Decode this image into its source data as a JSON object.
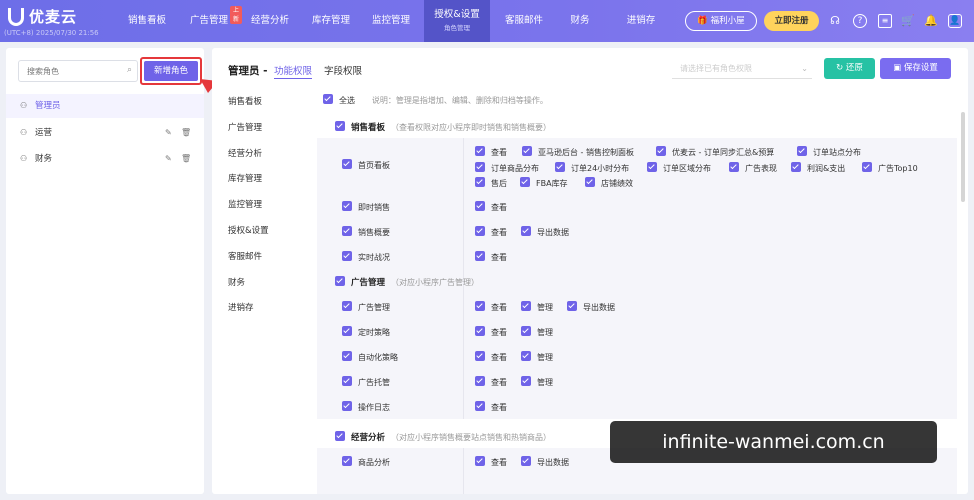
{
  "app": {
    "logo_text": "优麦云",
    "region_text": "(UTC+8) 2025/07/30 21:56"
  },
  "nav": [
    {
      "label": "销售看板"
    },
    {
      "label": "广告管理",
      "badge": "上新"
    },
    {
      "label": "经营分析"
    },
    {
      "label": "库存管理"
    },
    {
      "label": "监控管理"
    },
    {
      "label": "授权&设置",
      "sub": "角色管理"
    },
    {
      "label": "客服邮件"
    },
    {
      "label": "财务"
    },
    {
      "label": "进销存"
    }
  ],
  "header_actions": {
    "welfare_label": "福利小屋",
    "welfare_icon": "gift-icon",
    "register_label": "立即注册"
  },
  "header_icons": [
    "headset-icon",
    "help-icon",
    "message-icon",
    "cart-icon",
    "bell-icon",
    "user-icon"
  ],
  "left": {
    "search_placeholder": "搜索角色",
    "new_role_label": "新增角色",
    "roles": [
      {
        "label": "管理员",
        "active": true,
        "editable": false
      },
      {
        "label": "运营",
        "active": false,
        "editable": true
      },
      {
        "label": "财务",
        "active": false,
        "editable": true
      }
    ]
  },
  "main": {
    "title": "管理员 -",
    "tabs": [
      "功能权限",
      "字段权限"
    ],
    "copy_placeholder": "请选择已有角色权限",
    "restore_label": "还原",
    "save_label": "保存设置",
    "side_nav": [
      "销售看板",
      "广告管理",
      "经营分析",
      "库存管理",
      "监控管理",
      "授权&设置",
      "客服邮件",
      "财务",
      "进销存"
    ],
    "select_all": "全选",
    "select_all_note": "说明：管理是指增加、编辑、删除和归档等操作。",
    "sections": {
      "sales": {
        "label": "销售看板",
        "hint": "（查看权限对应小程序即时销售和销售概要）",
        "rows": [
          {
            "label": "首页看板",
            "perms": [
              "查看",
              "亚马逊后台 - 销售控制面板",
              "优麦云 - 订单同步汇总&预算",
              "订单站点分布",
              "订单商品分布",
              "订单24小时分布",
              "订单区域分布",
              "广告表现",
              "利润&支出",
              "广告Top10",
              "售后",
              "FBA库存",
              "店铺绩效"
            ]
          },
          {
            "label": "即时销售",
            "perms": [
              "查看"
            ]
          },
          {
            "label": "销售概要",
            "perms": [
              "查看",
              "导出数据"
            ]
          },
          {
            "label": "实时战况",
            "perms": [
              "查看"
            ]
          }
        ]
      },
      "ads": {
        "label": "广告管理",
        "hint": "（对应小程序广告管理）",
        "rows": [
          {
            "label": "广告管理",
            "perms": [
              "查看",
              "管理",
              "导出数据"
            ]
          },
          {
            "label": "定时策略",
            "perms": [
              "查看",
              "管理"
            ]
          },
          {
            "label": "自动化策略",
            "perms": [
              "查看",
              "管理"
            ]
          },
          {
            "label": "广告托管",
            "perms": [
              "查看",
              "管理"
            ]
          },
          {
            "label": "操作日志",
            "perms": [
              "查看"
            ]
          }
        ]
      },
      "ops": {
        "label": "经营分析",
        "hint": "（对应小程序销售概要站点销售和热销商品）",
        "rows": [
          {
            "label": "商品分析",
            "perms": [
              "查看",
              "导出数据"
            ]
          }
        ]
      }
    }
  },
  "watermark": "infinite-wanmei.com.cn",
  "colors": {
    "brand": "#6f63e8",
    "teal": "#26c2a4",
    "highlight": "#e5383b",
    "nav_bg": "#7470ea"
  }
}
